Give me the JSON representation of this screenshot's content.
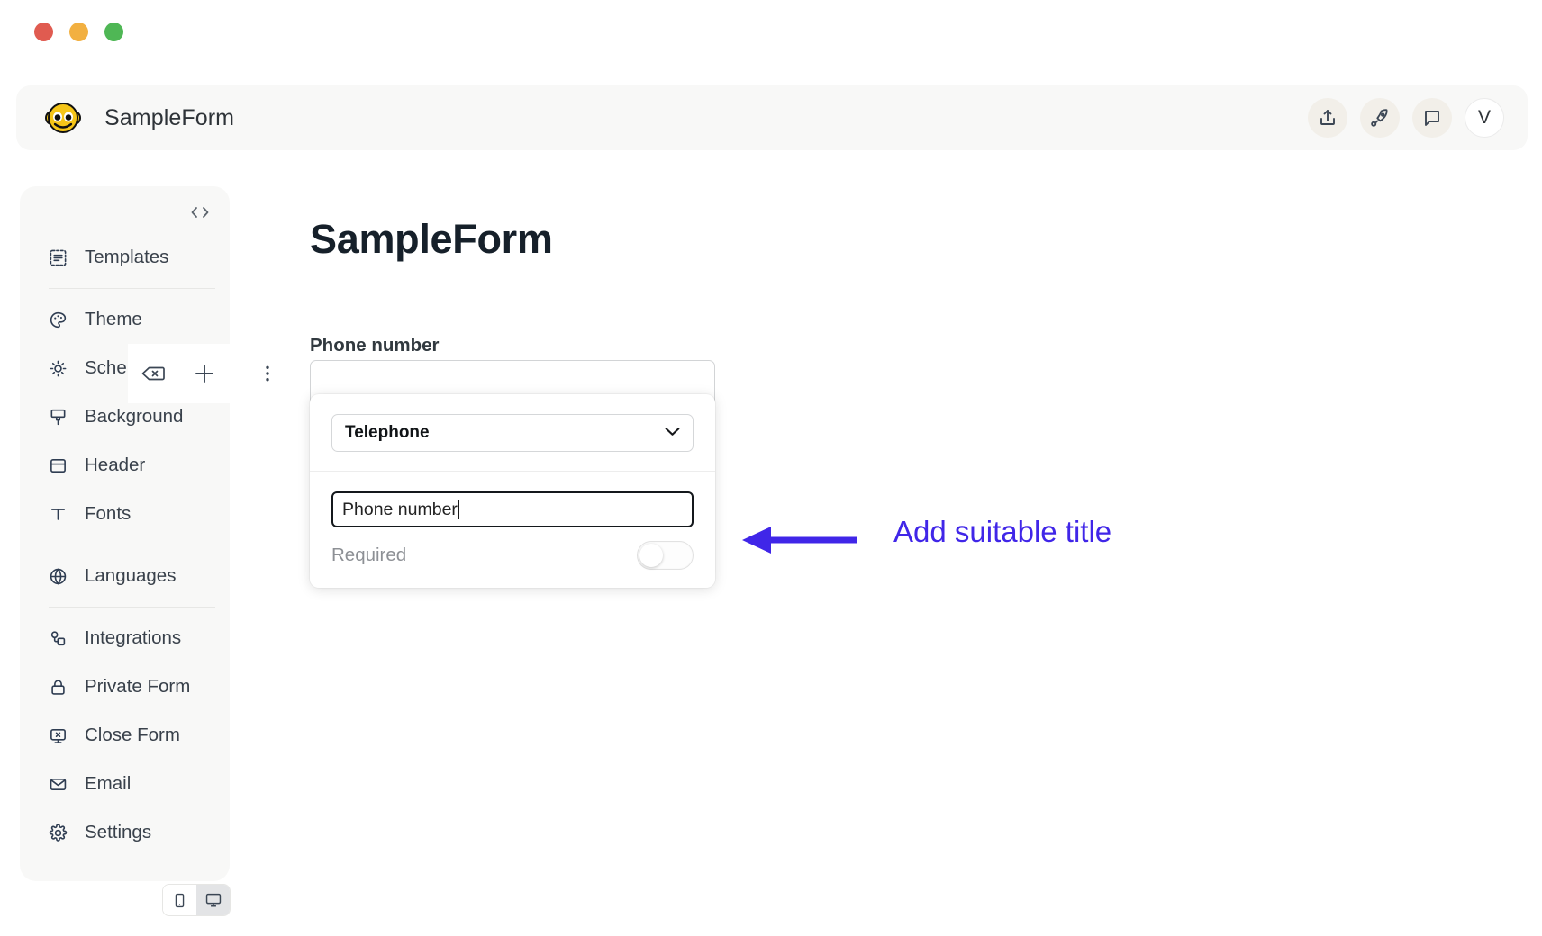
{
  "window": {
    "traffic_lights": [
      {
        "name": "close",
        "color": "#e05b50"
      },
      {
        "name": "minimize",
        "color": "#f2b041"
      },
      {
        "name": "zoom",
        "color": "#4fb755"
      }
    ]
  },
  "appbar": {
    "logo_icon": "monkey-logo-icon",
    "title": "SampleForm",
    "actions": [
      {
        "name": "share-icon",
        "label": "Share"
      },
      {
        "name": "rocket-icon",
        "label": "Publish"
      },
      {
        "name": "chat-icon",
        "label": "Messages"
      }
    ],
    "avatar_initial": "V"
  },
  "sidebar": {
    "code_toggle_icon": "code-brackets-icon",
    "items": [
      {
        "label": "Templates",
        "icon": "templates-icon"
      },
      {
        "label": "Theme",
        "icon": "palette-icon"
      },
      {
        "label": "Scheme",
        "icon": "sun-moon-icon"
      },
      {
        "label": "Background",
        "icon": "brush-icon"
      },
      {
        "label": "Header",
        "icon": "header-layout-icon"
      },
      {
        "label": "Fonts",
        "icon": "text-type-icon"
      },
      {
        "label": "Languages",
        "icon": "globe-icon"
      },
      {
        "label": "Integrations",
        "icon": "integrations-icon"
      },
      {
        "label": "Private Form",
        "icon": "lock-icon"
      },
      {
        "label": "Close Form",
        "icon": "close-form-icon"
      },
      {
        "label": "Email",
        "icon": "envelope-icon"
      },
      {
        "label": "Settings",
        "icon": "gear-icon"
      }
    ],
    "element_toolbar": [
      {
        "name": "delete-field-icon",
        "label": "Delete field"
      },
      {
        "name": "add-field-icon",
        "label": "Add field"
      }
    ],
    "more_menu_icon": "more-vertical-icon",
    "device_toggle": [
      {
        "name": "mobile-icon",
        "label": "Mobile",
        "active": false
      },
      {
        "name": "desktop-icon",
        "label": "Desktop",
        "active": true
      }
    ]
  },
  "form": {
    "title": "SampleForm",
    "field_label": "Phone number",
    "field_value": "",
    "field_placeholder": ""
  },
  "popover": {
    "field_type": "Telephone",
    "field_type_options": [
      "Telephone"
    ],
    "title_value": "Phone number",
    "required_label": "Required",
    "required_on": false
  },
  "annotation": {
    "text": "Add suitable title",
    "color": "#4026e8"
  }
}
